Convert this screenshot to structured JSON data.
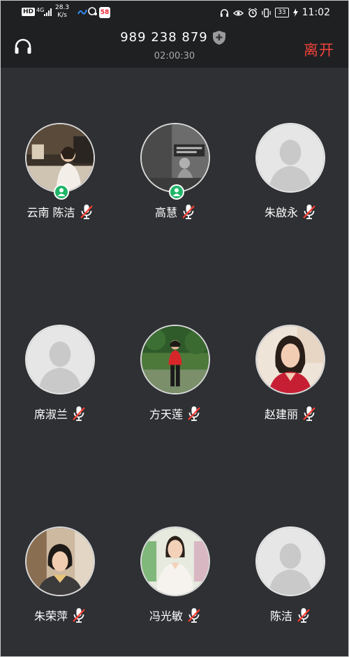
{
  "status_bar": {
    "hd": "HD",
    "network": "4G",
    "speed_value": "28.3",
    "speed_unit": "K/s",
    "battery": "33",
    "time": "11:02"
  },
  "header": {
    "meeting_number": "989 238 879",
    "duration": "02:00:30",
    "leave_label": "离开",
    "accent_color": "#f0433b"
  },
  "participants": [
    {
      "name": "云南 陈洁",
      "avatar": "photo-woman-room",
      "host_badge": true,
      "muted": true
    },
    {
      "name": "高慧",
      "avatar": "photo-bw-piano",
      "host_badge": true,
      "muted": true
    },
    {
      "name": "朱啟永",
      "avatar": "default-silhouette",
      "host_badge": false,
      "muted": true
    },
    {
      "name": "席淑兰",
      "avatar": "default-silhouette",
      "host_badge": false,
      "muted": true
    },
    {
      "name": "方天莲",
      "avatar": "photo-woman-garden",
      "host_badge": false,
      "muted": true
    },
    {
      "name": "赵建丽",
      "avatar": "photo-woman-red",
      "host_badge": false,
      "muted": true
    },
    {
      "name": "朱荣萍",
      "avatar": "photo-woman-portrait",
      "host_badge": false,
      "muted": true
    },
    {
      "name": "冯光敏",
      "avatar": "photo-woman-white",
      "host_badge": false,
      "muted": true
    },
    {
      "name": "陈洁",
      "avatar": "default-silhouette",
      "host_badge": false,
      "muted": true
    }
  ]
}
